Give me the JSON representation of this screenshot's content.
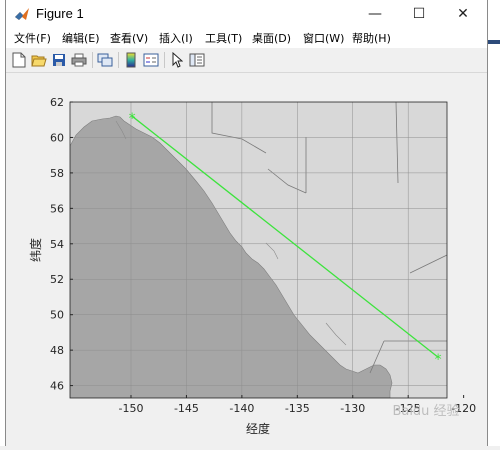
{
  "window": {
    "title": "Figure 1",
    "controls": {
      "minimize": "—",
      "maximize": "☐",
      "close": "✕"
    }
  },
  "menu": [
    {
      "label": "文件(F)"
    },
    {
      "label": "编辑(E)"
    },
    {
      "label": "查看(V)"
    },
    {
      "label": "插入(I)"
    },
    {
      "label": "工具(T)"
    },
    {
      "label": "桌面(D)"
    },
    {
      "label": "窗口(W)"
    },
    {
      "label": "帮助(H)"
    }
  ],
  "toolbar_icons": [
    "new-figure-icon",
    "open-icon",
    "save-icon",
    "print-icon",
    "link-figure-icon",
    "colorbar-icon",
    "legend-icon",
    "pointer-icon",
    "property-editor-icon"
  ],
  "colors": {
    "land": "#d8d8d8",
    "ocean": "#a6a6a6",
    "route": "#3de33d",
    "grid": "#8e8e8e"
  },
  "chart_data": {
    "type": "line",
    "xlabel": "经度",
    "ylabel": "纬度",
    "xlim": [
      -155.5,
      -121.5
    ],
    "ylim": [
      45.3,
      62.0
    ],
    "xticks": [
      -150,
      -145,
      -140,
      -135,
      -130,
      -125,
      -120
    ],
    "xtick_labels": [
      "-150",
      "-145",
      "-140",
      "-135",
      "-130",
      "-125",
      "-120"
    ],
    "yticks": [
      46,
      48,
      50,
      52,
      54,
      56,
      58,
      60,
      62
    ],
    "ytick_labels": [
      "46",
      "48",
      "50",
      "52",
      "54",
      "56",
      "58",
      "60",
      "62"
    ],
    "grid": true,
    "series": [
      {
        "x": [
          -149.9,
          -122.3
        ],
        "y": [
          61.2,
          47.6
        ],
        "marker": "*"
      }
    ]
  },
  "watermark": "Baidu 经验"
}
